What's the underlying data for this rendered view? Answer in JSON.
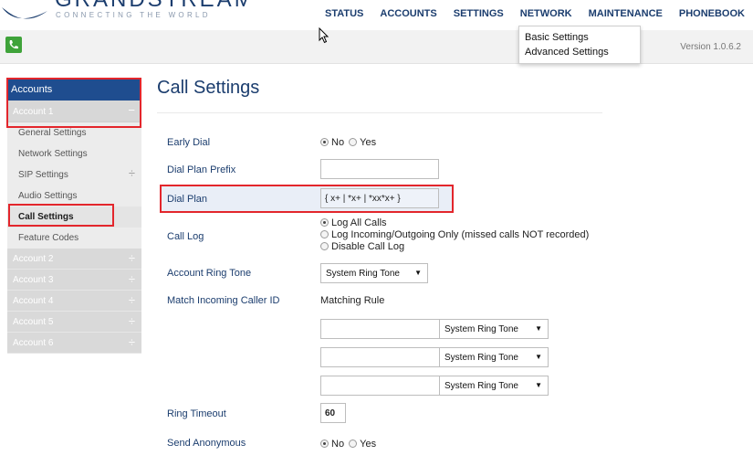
{
  "brand": {
    "wordmark": "GRANDSTREAM",
    "tagline": "CONNECTING THE WORLD"
  },
  "topnav": [
    "STATUS",
    "ACCOUNTS",
    "SETTINGS",
    "NETWORK",
    "MAINTENANCE",
    "PHONEBOOK"
  ],
  "network_menu": [
    "Basic Settings",
    "Advanced Settings"
  ],
  "version": "Version 1.0.6.2",
  "sidebar": {
    "header": "Accounts",
    "account1": "Account 1",
    "sub_items": [
      "General Settings",
      "Network Settings",
      "SIP Settings",
      "Audio Settings",
      "Call Settings",
      "Feature Codes"
    ],
    "accounts": [
      "Account 2",
      "Account 3",
      "Account 4",
      "Account 5",
      "Account 6"
    ]
  },
  "page_title": "Call Settings",
  "form": {
    "early_dial": {
      "label": "Early Dial",
      "options": [
        "No",
        "Yes"
      ],
      "selected": "No"
    },
    "dial_plan_prefix": {
      "label": "Dial Plan Prefix",
      "value": ""
    },
    "dial_plan": {
      "label": "Dial Plan",
      "value": "{ x+ | *x+ | *xx*x+ }"
    },
    "call_log": {
      "label": "Call Log",
      "options": [
        "Log All Calls",
        "Log Incoming/Outgoing Only (missed calls NOT recorded)",
        "Disable Call Log"
      ],
      "selected": "Log All Calls"
    },
    "account_ring_tone": {
      "label": "Account Ring Tone",
      "value": "System Ring Tone"
    },
    "match_incoming": {
      "label": "Match Incoming Caller ID",
      "header": "Matching Rule",
      "rules": [
        {
          "pattern": "",
          "tone": "System Ring Tone"
        },
        {
          "pattern": "",
          "tone": "System Ring Tone"
        },
        {
          "pattern": "",
          "tone": "System Ring Tone"
        }
      ]
    },
    "ring_timeout": {
      "label": "Ring Timeout",
      "value": "60"
    },
    "send_anonymous": {
      "label": "Send Anonymous",
      "options": [
        "No",
        "Yes"
      ],
      "selected": "No"
    }
  },
  "colors": {
    "brand_blue": "#1b3d6e",
    "highlight_red": "#e3262c",
    "phone_green": "#3fa33a"
  }
}
